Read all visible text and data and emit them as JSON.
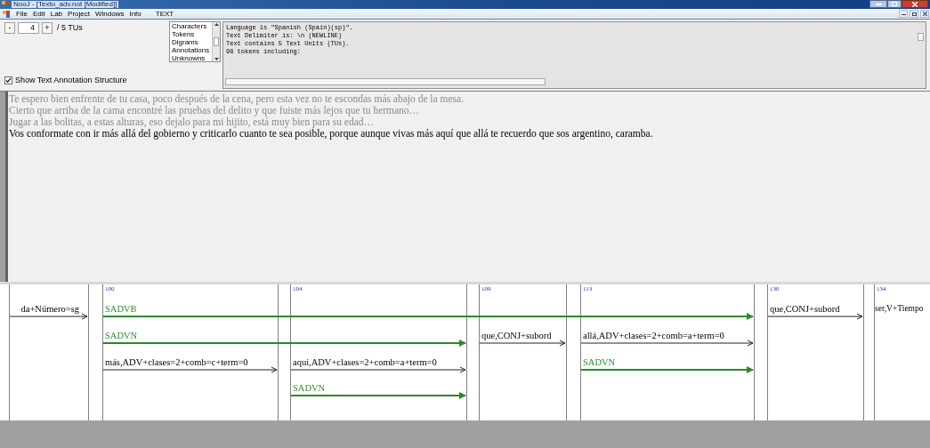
{
  "window": {
    "title": "NooJ - [Texto_adv.not [Modified]]"
  },
  "menu": [
    "File",
    "Edit",
    "Lab",
    "Project",
    "Windows",
    "Info",
    "TEXT"
  ],
  "navigator": {
    "minus": "-",
    "value": "4",
    "plus": "+",
    "total": "/ 5 TUs"
  },
  "show_structure": {
    "label": "Show Text Annotation Structure",
    "checked": true
  },
  "list": [
    "Characters",
    "Tokens",
    "Digrams",
    "Annotations",
    "Unknowns"
  ],
  "info_lines": [
    "Language is \"Spanish (Spain)(sp)\".",
    "Text Delimiter is: \\n (NEWLINE)",
    "Text contains 5 Text Units (TUs).",
    "98 tokens including:"
  ],
  "text_units": [
    {
      "text": "Te espero bien enfrente de tu casa, poco después de la cena, pero esta vez no te escondas más abajo de la mesa.",
      "selected": false
    },
    {
      "text": "Cierto que arriba de la cama encontré las pruebas del delito y que fuiste más lejos que tu hermano…",
      "selected": false
    },
    {
      "text": "Jugar a las bolitas, a estas alturas, eso dejalo para mi hijito, está muy bien para su edad…",
      "selected": false
    },
    {
      "text": "Vos conformate con ir más allá del gobierno y criticarlo cuanto te sea posible, porque aunque vivas más aquí que allá te recuerdo que sos argentino, caramba.",
      "selected": true
    }
  ],
  "structure": {
    "columns": [
      {},
      {
        "number": "100"
      },
      {
        "number": "104"
      },
      {
        "number": "109"
      },
      {
        "number": "113"
      },
      {
        "number": "130"
      },
      {
        "number": "134"
      }
    ],
    "lanes": [
      {
        "cells": [
          {
            "kind": "lexical",
            "label": "da+Número=sg"
          },
          {
            "kind": "syntactic",
            "label": "SADVB"
          },
          {
            "kind": "continuation"
          },
          {
            "kind": "continuation"
          },
          {
            "kind": "continuation"
          },
          {
            "kind": "lexical",
            "label": "que,CONJ+subord"
          },
          {
            "kind": "cut",
            "label": "ser,V+Tiempo"
          }
        ]
      },
      {
        "cells": [
          {
            "kind": "empty"
          },
          {
            "kind": "syntactic",
            "label": "SADVN"
          },
          {
            "kind": "continuation"
          },
          {
            "kind": "lexical",
            "label": "que,CONJ+subord"
          },
          {
            "kind": "lexical",
            "label": "allá,ADV+clases=2+comb=a+term=0"
          }
        ]
      },
      {
        "cells": [
          {
            "kind": "empty"
          },
          {
            "kind": "lexical",
            "label": "más,ADV+clases=2+comb=c+term=0"
          },
          {
            "kind": "lexical",
            "label": "aqui,ADV+clases=2+comb=a+term=0"
          },
          {
            "kind": "empty"
          },
          {
            "kind": "syntactic",
            "label": "SADVN"
          }
        ]
      },
      {
        "cells": [
          {
            "kind": "empty"
          },
          {
            "kind": "empty"
          },
          {
            "kind": "syntactic",
            "label": "SADVN"
          }
        ]
      }
    ]
  }
}
